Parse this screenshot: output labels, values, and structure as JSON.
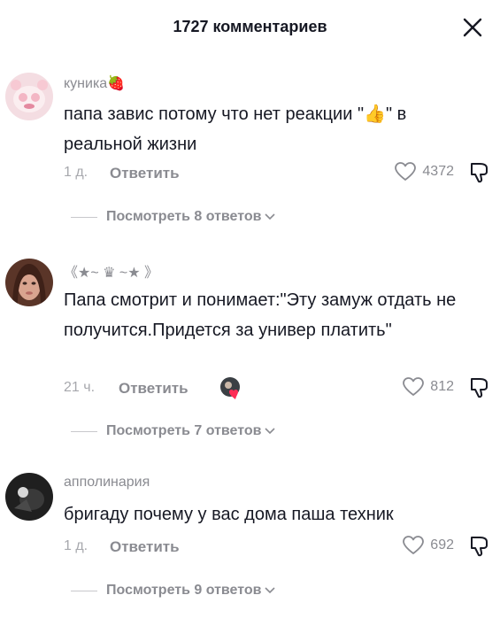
{
  "header": {
    "title": "1727 комментариев"
  },
  "comments": [
    {
      "username": "куника🍓",
      "text": "папа завис потому что нет реакции \"👍\" в реальной жизни",
      "time": "1 д.",
      "reply_label": "Ответить",
      "likes": "4372",
      "view_replies": "Посмотреть 8 ответов"
    },
    {
      "username": "《★~ ♛ ~★ 》",
      "text": "Папа смотрит и понимает:\"Эту замуж отдать не получится.Придется за универ платить\"",
      "time": "21 ч.",
      "reply_label": "Ответить",
      "likes": "812",
      "view_replies": "Посмотреть 7 ответов"
    },
    {
      "username": "апполинария",
      "text": "бригаду почему у вас дома паша техник",
      "time": "1 д.",
      "reply_label": "Ответить",
      "likes": "692",
      "view_replies": "Посмотреть 9 ответов"
    }
  ],
  "colors": {
    "text": "#161823",
    "secondary": "#8a8b91",
    "heart": "#fe2c55"
  }
}
